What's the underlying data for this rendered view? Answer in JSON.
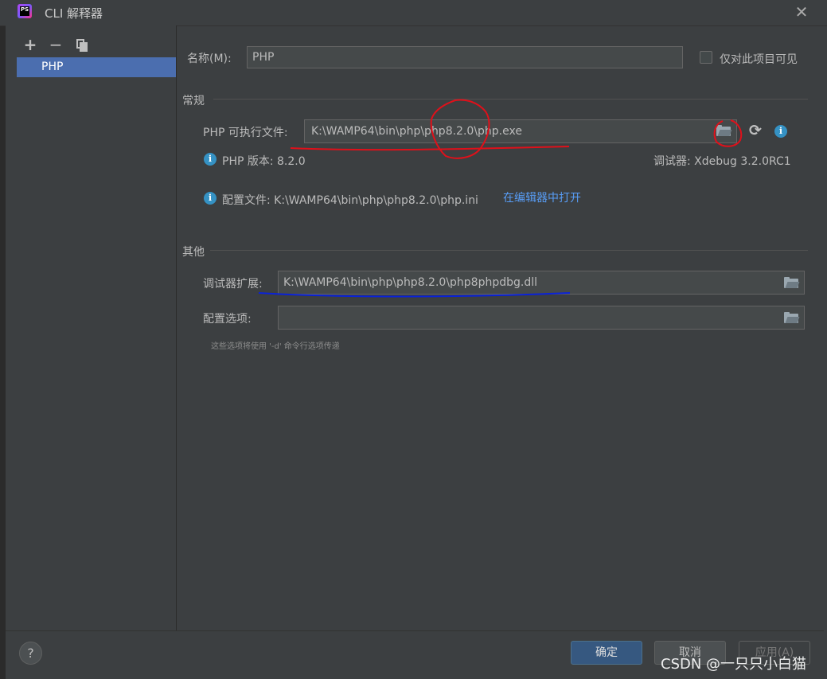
{
  "window": {
    "title": "CLI 解释器",
    "app_icon_text": "PS"
  },
  "sidebar": {
    "items": [
      {
        "label": "PHP"
      }
    ]
  },
  "form": {
    "name_label": "名称(M):",
    "name_value": "PHP",
    "visible_only_label": "仅对此项目可见",
    "general_title": "常规",
    "php_exe_label": "PHP 可执行文件:",
    "php_exe_value": "K:\\WAMP64\\bin\\php\\php8.2.0\\php.exe",
    "php_version_text": "PHP 版本: 8.2.0",
    "debugger_text": "调试器: Xdebug 3.2.0RC1",
    "config_file_text": "配置文件: K:\\WAMP64\\bin\\php\\php8.2.0\\php.ini",
    "open_in_editor_link": "在编辑器中打开",
    "other_title": "其他",
    "debugger_ext_label": "调试器扩展:",
    "debugger_ext_value": "K:\\WAMP64\\bin\\php\\php8.2.0\\php8phpdbg.dll",
    "config_options_label": "配置选项:",
    "config_options_value": "",
    "config_options_hint": "这些选项将使用 '-d' 命令行选项传递"
  },
  "buttons": {
    "ok": "确定",
    "cancel": "取消",
    "apply": "应用(A)",
    "help": "?"
  },
  "watermark": "CSDN @一只只小白猫",
  "colors": {
    "background": "#3c3f41",
    "selection": "#4b6eaf",
    "link": "#589df6",
    "ok_button": "#365880",
    "annotation_red": "#e0101a",
    "annotation_blue": "#0a22d8"
  },
  "icons": [
    "close-icon",
    "plus-icon",
    "minus-icon",
    "copy-icon",
    "folder-icon",
    "refresh-icon",
    "info-icon"
  ]
}
